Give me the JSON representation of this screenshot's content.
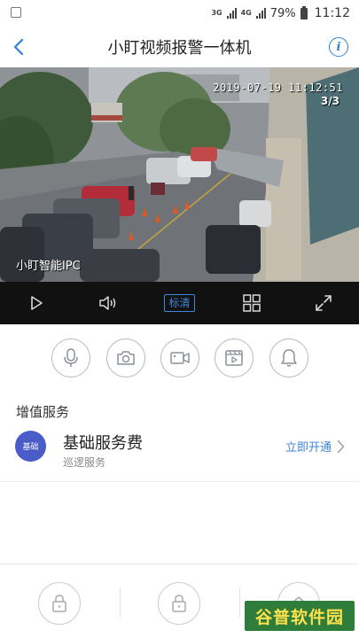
{
  "status_bar": {
    "network_1": "3G",
    "network_2": "4G",
    "battery_percent": "79%",
    "time": "11:12"
  },
  "header": {
    "title": "小盯视频报警一体机",
    "back_icon": "chevron-left-icon",
    "info_icon": "info-icon",
    "info_glyph": "i",
    "accent_color": "#2f7fd6"
  },
  "video": {
    "timestamp": "2019-07-19 11:12:51",
    "page_indicator": "3/3",
    "camera_label": "小盯智能IPC"
  },
  "video_toolbar": {
    "quality_label": "标清",
    "icons": [
      "play-icon",
      "volume-icon",
      "quality-button",
      "grid-icon",
      "fullscreen-icon"
    ]
  },
  "actions": {
    "icons": [
      "microphone-icon",
      "camera-icon",
      "video-record-icon",
      "playback-icon",
      "alarm-bell-icon"
    ]
  },
  "services": {
    "section_title": "增值服务",
    "items": [
      {
        "badge": "基础",
        "name": "基础服务费",
        "sub": "巡逻服务",
        "action": "立即开通"
      }
    ]
  },
  "bottom_nav": {
    "icons": [
      "lock-icon",
      "lock-icon",
      "home-icon"
    ]
  },
  "watermark": {
    "text": "谷普软件园",
    "background": "#2e7d3a",
    "color": "#ffe14d"
  }
}
